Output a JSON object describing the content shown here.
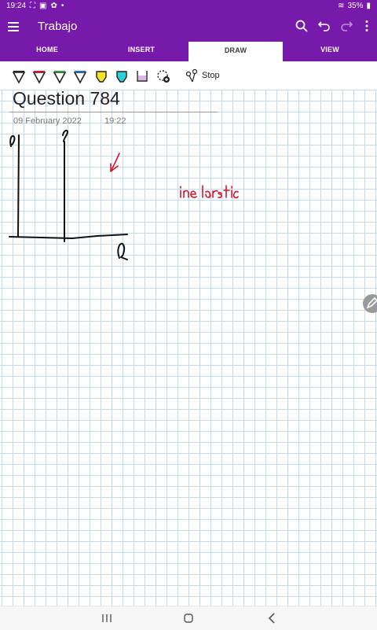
{
  "status": {
    "time": "19:24",
    "battery": "35%"
  },
  "appbar": {
    "title": "Trabajo"
  },
  "tabs": [
    {
      "label": "HOME",
      "active": false
    },
    {
      "label": "INSERT",
      "active": false
    },
    {
      "label": "DRAW",
      "active": true
    },
    {
      "label": "VIEW",
      "active": false
    }
  ],
  "toolbar": {
    "tools": [
      "black-pen-icon",
      "magenta-pen-icon",
      "green-pen-icon",
      "blue-pen-icon",
      "yellow-highlighter-icon",
      "cyan-highlighter-icon",
      "purple-highlighter-icon",
      "add-pen-icon"
    ],
    "stop_label": "Stop"
  },
  "page": {
    "title": "Question 784",
    "date": "09 February 2022",
    "time": "19:22"
  },
  "colors": {
    "brand": "#7719aa",
    "grid": "#c6dcec",
    "ink_red": "#d0182a"
  }
}
